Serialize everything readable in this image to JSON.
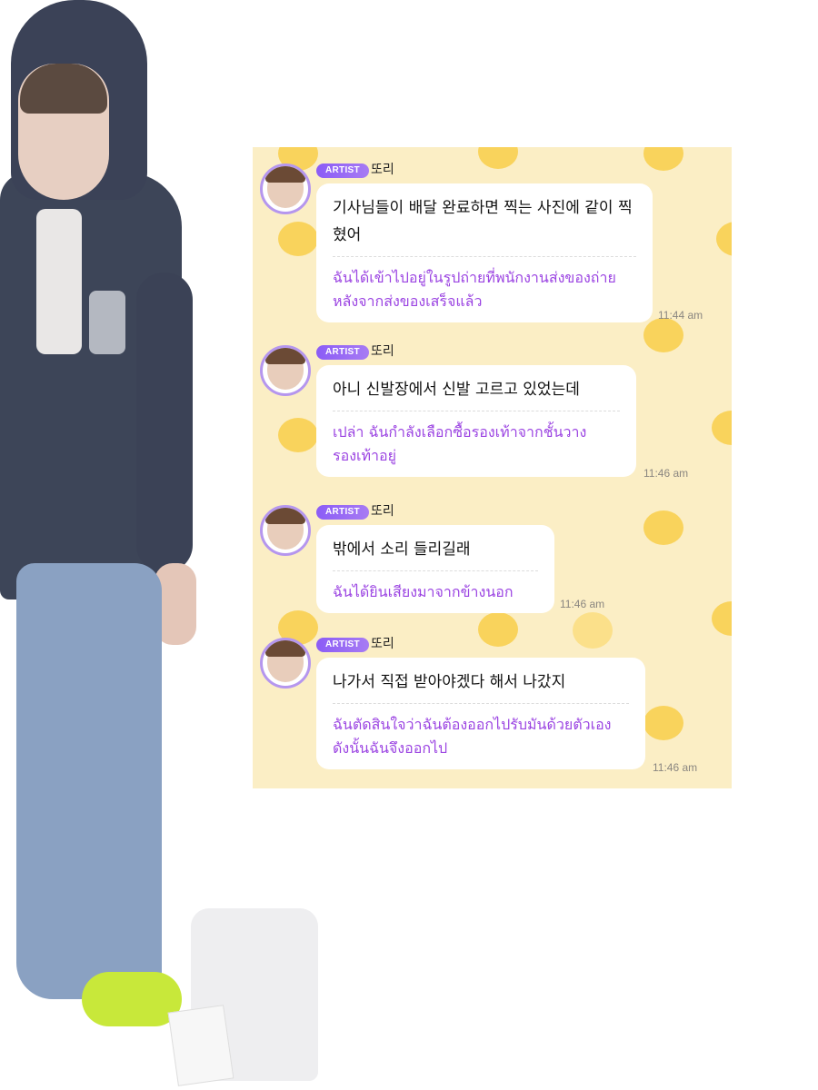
{
  "messages": [
    {
      "badge": "ARTIST",
      "sender": "또리",
      "korean": "기사님들이 배달 완료하면 찍는 사진에 같이 찍혔어",
      "thai": "ฉันได้เข้าไปอยู่ในรูปถ่ายที่พนักงานส่งของถ่ายหลังจากส่งของเสร็จแล้ว",
      "time": "11:44 am"
    },
    {
      "badge": "ARTIST",
      "sender": "또리",
      "korean": "아니 신발장에서 신발 고르고 있었는데",
      "thai": "เปล่า ฉันกำลังเลือกซื้อรองเท้าจากชั้นวางรองเท้าอยู่",
      "time": "11:46 am"
    },
    {
      "badge": "ARTIST",
      "sender": "또리",
      "korean": "밖에서 소리 들리길래",
      "thai": "ฉันได้ยินเสียงมาจากข้างนอก",
      "time": "11:46 am"
    },
    {
      "badge": "ARTIST",
      "sender": "또리",
      "korean": "나가서 직접 받아야겠다 해서 나갔지",
      "thai": "ฉันตัดสินใจว่าฉันต้องออกไปรับมันด้วยตัวเอง ดังนั้นฉันจึงออกไป",
      "time": "11:46 am"
    }
  ],
  "colors": {
    "chat_background": "#fbeec5",
    "polka_dot": "#f9d35c",
    "badge": "#8b5cf6",
    "translation_text": "#9b44e2",
    "bubble": "#ffffff"
  }
}
